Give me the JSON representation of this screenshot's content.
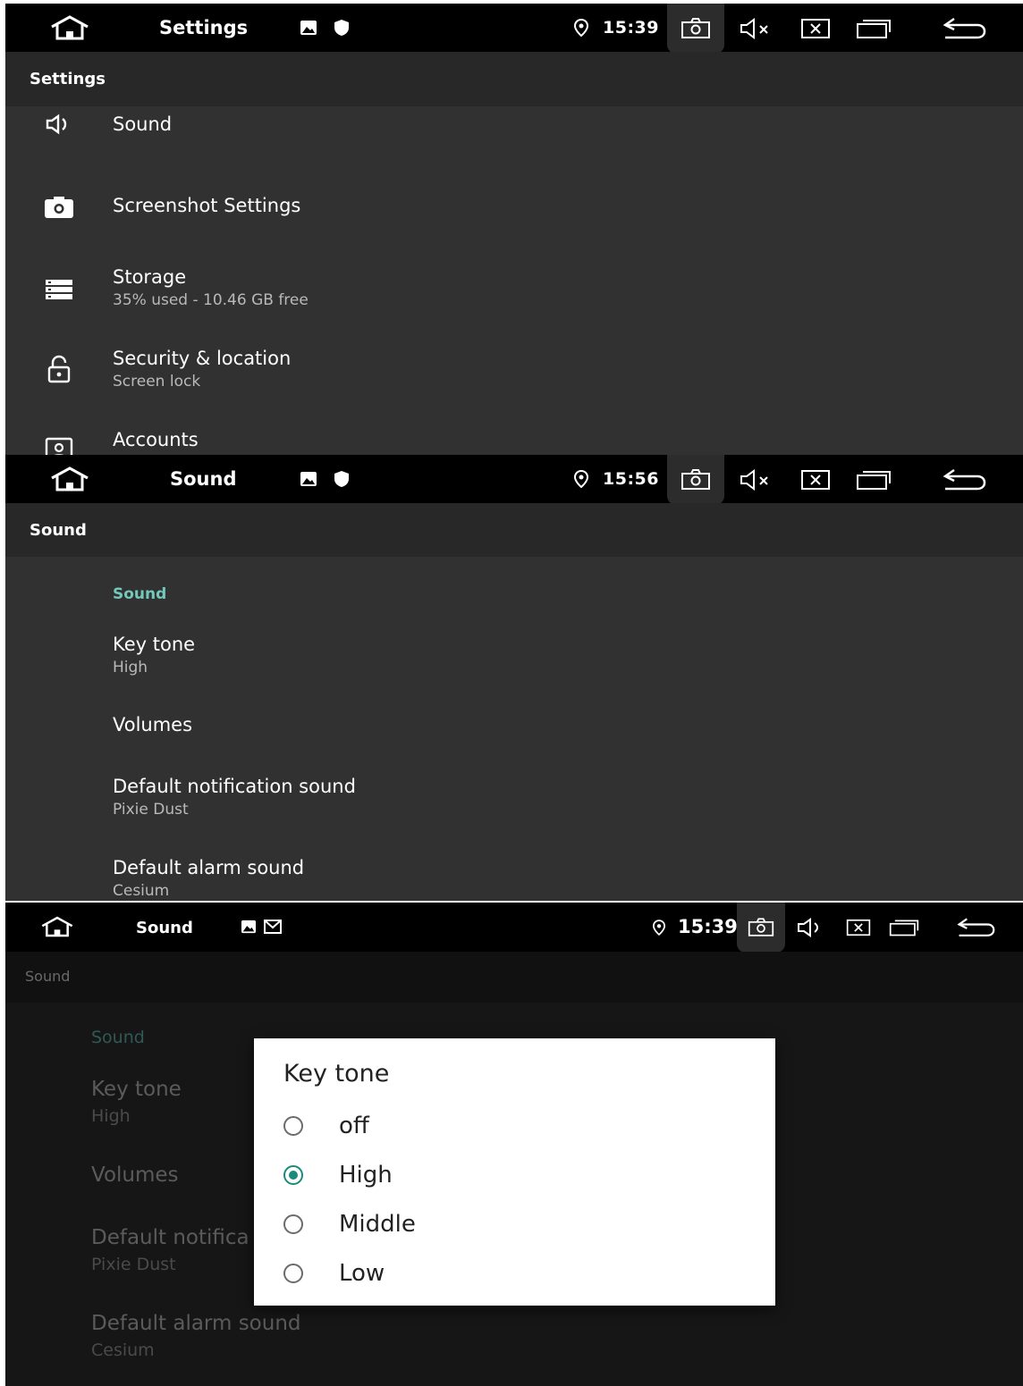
{
  "panels": [
    {
      "status": {
        "title": "Settings",
        "time": "15:39"
      },
      "appbar_title": "Settings",
      "items": [
        {
          "title": "Sound",
          "subtitle": "",
          "icon": "speaker-icon"
        },
        {
          "title": "Screenshot Settings",
          "subtitle": "",
          "icon": "camera-icon"
        },
        {
          "title": "Storage",
          "subtitle": "35% used - 10.46 GB free",
          "icon": "storage-icon"
        },
        {
          "title": "Security & location",
          "subtitle": "Screen lock",
          "icon": "lock-icon"
        },
        {
          "title": "Accounts",
          "subtitle": "",
          "icon": "account-icon"
        }
      ]
    },
    {
      "status": {
        "title": "Sound",
        "time": "15:56"
      },
      "appbar_title": "Sound",
      "section": "Sound",
      "items": [
        {
          "title": "Key tone",
          "subtitle": "High"
        },
        {
          "title": "Volumes",
          "subtitle": ""
        },
        {
          "title": "Default notification sound",
          "subtitle": "Pixie Dust"
        },
        {
          "title": "Default alarm sound",
          "subtitle": "Cesium"
        }
      ]
    },
    {
      "status": {
        "title": "Sound",
        "time": "15:39"
      },
      "appbar_title": "Sound",
      "section": "Sound",
      "items": [
        {
          "title": "Key tone",
          "subtitle": "High"
        },
        {
          "title": "Volumes",
          "subtitle": ""
        },
        {
          "title": "Default notifica",
          "subtitle": "Pixie Dust"
        },
        {
          "title": "Default alarm sound",
          "subtitle": "Cesium"
        }
      ],
      "dialog": {
        "title": "Key tone",
        "options": [
          "off",
          "High",
          "Middle",
          "Low"
        ],
        "selected": "High"
      }
    }
  ],
  "colors": {
    "accent": "#1a8a7a",
    "section": "#73c8b9",
    "background": "#313131",
    "statusbar": "#000000"
  }
}
